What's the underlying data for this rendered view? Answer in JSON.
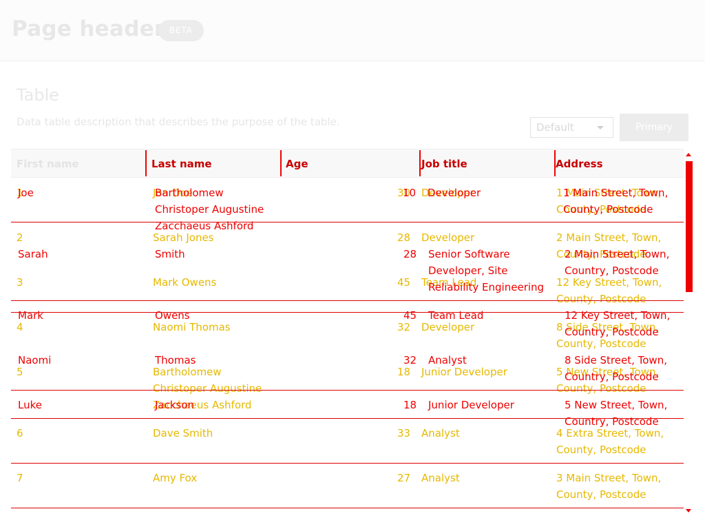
{
  "header": {
    "title": "Page header",
    "badge": "BETA"
  },
  "table": {
    "title": "Table",
    "description": "Data table description that describes the purpose of the table.",
    "select_value": "Default",
    "primary_label": "Primary",
    "columns": [
      "First name",
      "Last name",
      "Age",
      "Job title",
      "Address"
    ],
    "rows": [
      [
        "1",
        "Jon Doe",
        "30",
        "Developer",
        "1 Main Street, Town, County, Postcode"
      ],
      [
        "2",
        "Sarah Jones",
        "28",
        "Developer",
        "2 Main Street, Town, County, Postcode"
      ],
      [
        "3",
        "Mark Owens",
        "45",
        "Team Lead",
        "12 Key Street, Town, County, Postcode"
      ],
      [
        "4",
        "Naomi Thomas",
        "32",
        "Developer",
        "8 Side Street, Town, County, Postcode"
      ],
      [
        "5",
        "Bartholomew Christoper Augustine Zacchaeus Ashford",
        "18",
        "Junior Developer",
        "5 New Street, Town, County, Postcode"
      ],
      [
        "6",
        "Dave Smith",
        "33",
        "Analyst",
        "4 Extra Street, Town, County, Postcode"
      ],
      [
        "7",
        "Amy Fox",
        "27",
        "Analyst",
        "3 Main Street, Town, County, Postcode"
      ]
    ],
    "overlay_rows": [
      [
        "Joe",
        "Bartholomew Christoper Augustine Zacchaeus Ashford",
        "10",
        "Developer",
        "1 Main Street, Town, County, Postcode"
      ],
      [
        "Sarah",
        "Smith",
        "28",
        "Senior Software Developer, Site Reliability Engineering",
        "2 Main Street, Town, Country, Postcode"
      ],
      [
        "Mark",
        "Owens",
        "45",
        "Team Lead",
        "12 Key Street, Town, Country, Postcode"
      ],
      [
        "Naomi",
        "Thomas",
        "32",
        "Analyst",
        "8 Side Street, Town, Country, Postcode"
      ],
      [
        "Luke",
        "Jackson",
        "18",
        "Junior Developer",
        "5 New Street, Town, Country, Postcode"
      ]
    ]
  },
  "colors": {
    "accent": "#ee0000",
    "value": "#e6b800",
    "muted": "#e6e6e6"
  }
}
